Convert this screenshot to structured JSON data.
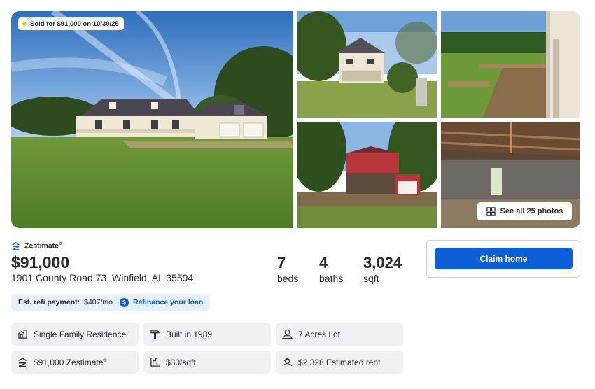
{
  "gallery": {
    "sold_badge": "Sold for $91,000 on 10/30/25",
    "see_all_label": "See all 25 photos",
    "photos": [
      "house-exterior-front",
      "house-rear-exterior",
      "wooden-deck",
      "red-barn-garage",
      "barn-interior"
    ]
  },
  "summary": {
    "zestimate_brand": "Zestimate",
    "zestimate_mark": "®",
    "price": "$91,000",
    "address": "1901 County Road 73, Winfield, AL 35594",
    "beds": {
      "value": "7",
      "label": "beds"
    },
    "baths": {
      "value": "4",
      "label": "baths"
    },
    "sqft": {
      "value": "3,024",
      "label": "sqft"
    }
  },
  "refi": {
    "label": "Est. refi payment:",
    "value": "$407/mo",
    "dollar_symbol": "$",
    "link": "Refinance your loan"
  },
  "facts": [
    {
      "text": "Single Family Residence",
      "icon": "house-type-icon"
    },
    {
      "text": "Built in 1989",
      "icon": "hammer-icon"
    },
    {
      "text": "7 Acres Lot",
      "icon": "lot-size-icon"
    },
    {
      "text": "$91,000 Zestimate",
      "mark": "®",
      "icon": "zestimate-icon"
    },
    {
      "text": "$30/sqft",
      "icon": "price-per-sqft-icon"
    },
    {
      "text": "$2,328 Estimated rent",
      "icon": "rent-icon"
    }
  ],
  "claim": {
    "button_label": "Claim home"
  },
  "colors": {
    "primary_blue": "#0d5fd8",
    "refi_bg": "#e6f1fd",
    "chip_bg": "#f1f1f4",
    "text": "#2a2a33",
    "sold_dot": "#f5c518"
  }
}
